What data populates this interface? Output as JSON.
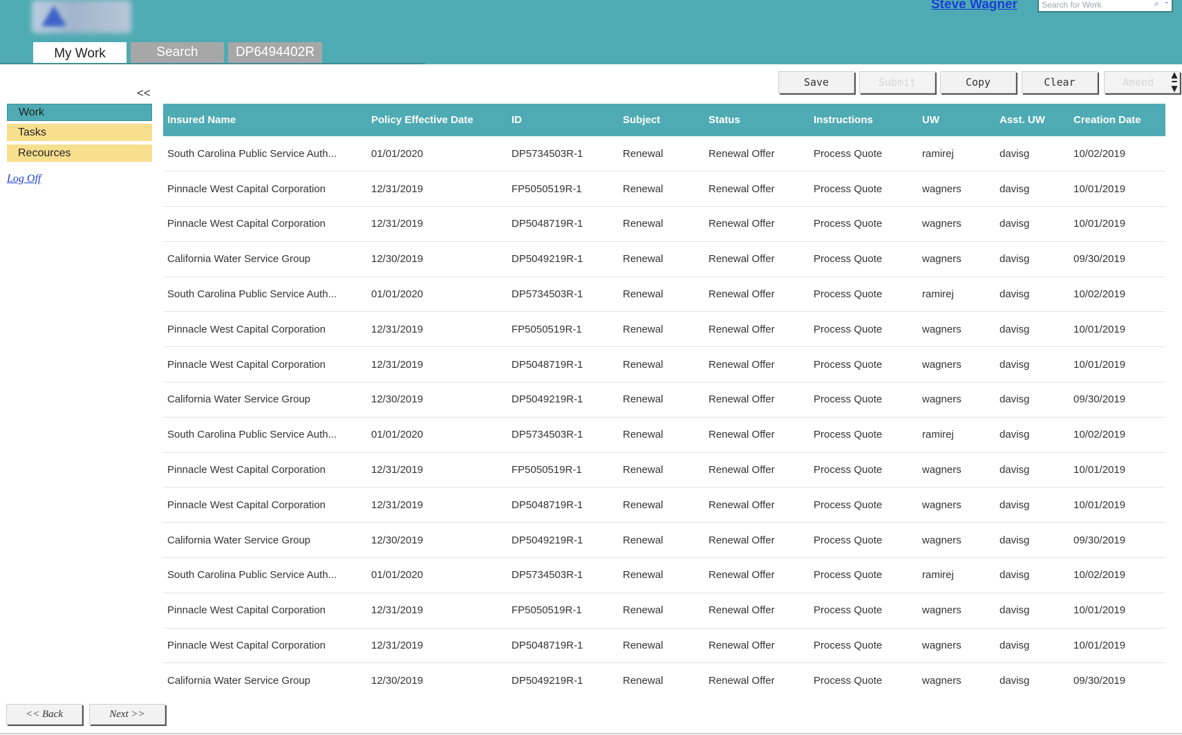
{
  "header": {
    "user_name": "Steve Wagner",
    "search_placeholder": "Search for Work",
    "colors": {
      "header_bg": "#4fabb3",
      "link": "#1a3fd6",
      "nav_highlight": "#f8df8e"
    }
  },
  "tabs": [
    {
      "label": "My Work",
      "active": true
    },
    {
      "label": "Search",
      "active": false
    },
    {
      "label": "DP6494402R",
      "active": false
    }
  ],
  "sidebar": {
    "collapse_label": "<<",
    "items": [
      {
        "label": "Work"
      },
      {
        "label": "Tasks"
      },
      {
        "label": "Recources"
      }
    ],
    "logoff_label": "Log Off"
  },
  "toolbar": {
    "save": "Save",
    "submit": "Submit",
    "copy": "Copy",
    "clear": "Clear",
    "amend": "Amend"
  },
  "table": {
    "columns": [
      "Insured Name",
      "Policy Effective Date",
      "ID",
      "Subject",
      "Status",
      "Instructions",
      "UW",
      "Asst. UW",
      "Creation Date"
    ],
    "rows": [
      [
        "South Carolina Public Service Auth...",
        "01/01/2020",
        "DP5734503R-1",
        "Renewal",
        "Renewal Offer",
        "Process Quote",
        "ramirej",
        "davisg",
        "10/02/2019"
      ],
      [
        "Pinnacle West Capital Corporation",
        "12/31/2019",
        "FP5050519R-1",
        "Renewal",
        "Renewal Offer",
        "Process Quote",
        "wagners",
        "davisg",
        "10/01/2019"
      ],
      [
        "Pinnacle West Capital Corporation",
        "12/31/2019",
        "DP5048719R-1",
        "Renewal",
        "Renewal Offer",
        "Process Quote",
        "wagners",
        "davisg",
        "10/01/2019"
      ],
      [
        "California Water Service Group",
        "12/30/2019",
        "DP5049219R-1",
        "Renewal",
        "Renewal Offer",
        "Process Quote",
        "wagners",
        "davisg",
        "09/30/2019"
      ],
      [
        "South Carolina Public Service Auth...",
        "01/01/2020",
        "DP5734503R-1",
        "Renewal",
        "Renewal Offer",
        "Process Quote",
        "ramirej",
        "davisg",
        "10/02/2019"
      ],
      [
        "Pinnacle West Capital Corporation",
        "12/31/2019",
        "FP5050519R-1",
        "Renewal",
        "Renewal Offer",
        "Process Quote",
        "wagners",
        "davisg",
        "10/01/2019"
      ],
      [
        "Pinnacle West Capital Corporation",
        "12/31/2019",
        "DP5048719R-1",
        "Renewal",
        "Renewal Offer",
        "Process Quote",
        "wagners",
        "davisg",
        "10/01/2019"
      ],
      [
        "California Water Service Group",
        "12/30/2019",
        "DP5049219R-1",
        "Renewal",
        "Renewal Offer",
        "Process Quote",
        "wagners",
        "davisg",
        "09/30/2019"
      ],
      [
        "South Carolina Public Service Auth...",
        "01/01/2020",
        "DP5734503R-1",
        "Renewal",
        "Renewal Offer",
        "Process Quote",
        "ramirej",
        "davisg",
        "10/02/2019"
      ],
      [
        "Pinnacle West Capital Corporation",
        "12/31/2019",
        "FP5050519R-1",
        "Renewal",
        "Renewal Offer",
        "Process Quote",
        "wagners",
        "davisg",
        "10/01/2019"
      ],
      [
        "Pinnacle West Capital Corporation",
        "12/31/2019",
        "DP5048719R-1",
        "Renewal",
        "Renewal Offer",
        "Process Quote",
        "wagners",
        "davisg",
        "10/01/2019"
      ],
      [
        "California Water Service Group",
        "12/30/2019",
        "DP5049219R-1",
        "Renewal",
        "Renewal Offer",
        "Process Quote",
        "wagners",
        "davisg",
        "09/30/2019"
      ],
      [
        "South Carolina Public Service Auth...",
        "01/01/2020",
        "DP5734503R-1",
        "Renewal",
        "Renewal Offer",
        "Process Quote",
        "ramirej",
        "davisg",
        "10/02/2019"
      ],
      [
        "Pinnacle West Capital Corporation",
        "12/31/2019",
        "FP5050519R-1",
        "Renewal",
        "Renewal Offer",
        "Process Quote",
        "wagners",
        "davisg",
        "10/01/2019"
      ],
      [
        "Pinnacle West Capital Corporation",
        "12/31/2019",
        "DP5048719R-1",
        "Renewal",
        "Renewal Offer",
        "Process Quote",
        "wagners",
        "davisg",
        "10/01/2019"
      ],
      [
        "California Water Service Group",
        "12/30/2019",
        "DP5049219R-1",
        "Renewal",
        "Renewal Offer",
        "Process Quote",
        "wagners",
        "davisg",
        "09/30/2019"
      ]
    ]
  },
  "footer": {
    "back_label": "<< Back",
    "next_label": "Next >>"
  }
}
